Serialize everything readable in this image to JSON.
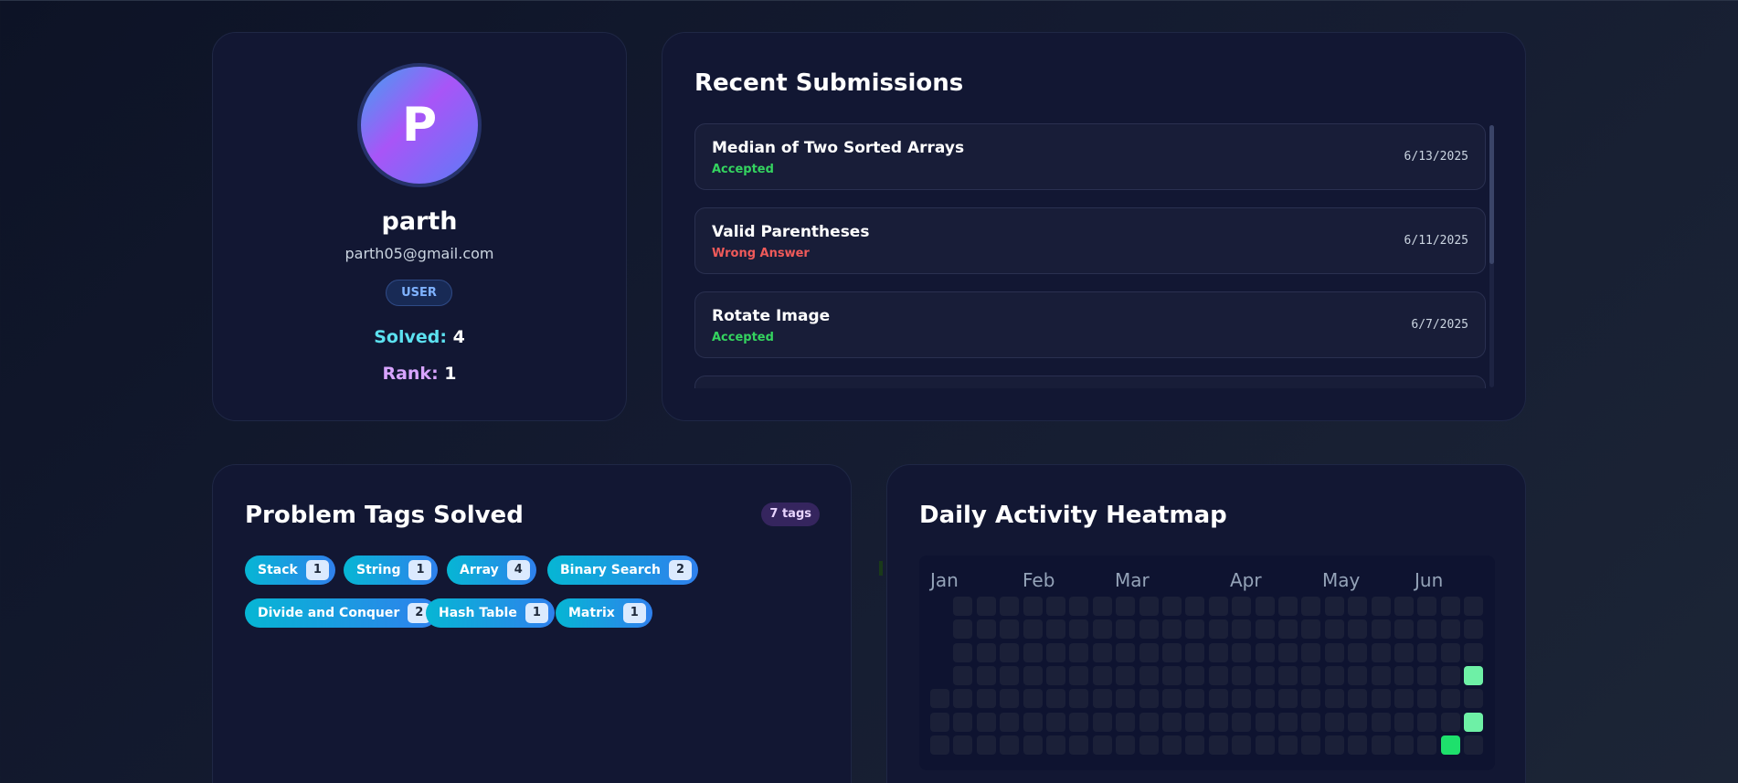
{
  "profile": {
    "avatar_letter": "P",
    "username": "parth",
    "email": "parth05@gmail.com",
    "role": "USER",
    "solved_label": "Solved:",
    "solved_value": "4",
    "rank_label": "Rank:",
    "rank_value": "1"
  },
  "submissions": {
    "title": "Recent Submissions",
    "items": [
      {
        "title": "Median of Two Sorted Arrays",
        "status": "Accepted",
        "date": "6/13/2025"
      },
      {
        "title": "Valid Parentheses",
        "status": "Wrong Answer",
        "date": "6/11/2025"
      },
      {
        "title": "Rotate Image",
        "status": "Accepted",
        "date": "6/7/2025"
      }
    ]
  },
  "tags": {
    "title": "Problem Tags Solved",
    "count_label": "7 tags",
    "items": [
      {
        "name": "Stack",
        "count": "1"
      },
      {
        "name": "String",
        "count": "1"
      },
      {
        "name": "Array",
        "count": "4"
      },
      {
        "name": "Binary Search",
        "count": "2"
      },
      {
        "name": "Divide and Conquer",
        "count": "2"
      },
      {
        "name": "Hash Table",
        "count": "1"
      },
      {
        "name": "Matrix",
        "count": "1"
      }
    ]
  },
  "heatmap": {
    "title": "Daily Activity Heatmap",
    "months": [
      "Jan",
      "Feb",
      "Mar",
      "Apr",
      "May",
      "Jun"
    ],
    "weeks": 24,
    "active_days": [
      {
        "week": 23,
        "day": 3,
        "level": 2
      },
      {
        "week": 23,
        "day": 5,
        "level": 2
      },
      {
        "week": 22,
        "day": 6,
        "level": 3
      }
    ]
  },
  "colors": {
    "accepted": "#34d35f",
    "wrong_answer": "#f05a5a",
    "solved_label": "#5ce1f0",
    "rank_label": "#d8a4ff"
  }
}
